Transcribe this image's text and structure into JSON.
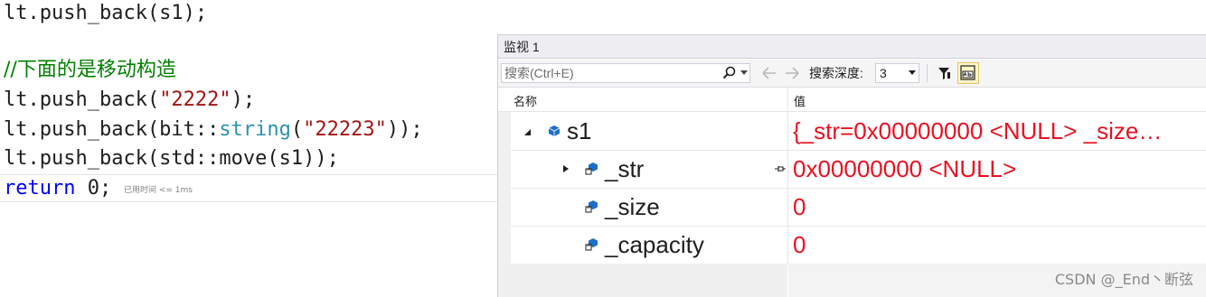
{
  "editor": {
    "line1": {
      "prefix": "lt.push_back(s1);"
    },
    "line3": {
      "comment": "//下面的是移动构造"
    },
    "line4": {
      "a": "lt.push_back(",
      "str": "\"2222\"",
      "b": ");"
    },
    "line5": {
      "a": "lt.push_back(bit::",
      "type": "string",
      "b": "(",
      "str": "\"22223\"",
      "c": "));"
    },
    "line6": {
      "text": "lt.push_back(std::move(s1));"
    },
    "line7": {
      "kw": "return",
      "b": " 0;"
    },
    "elapsed": "已用时间 <= 1ms"
  },
  "watch": {
    "title": "监视 1",
    "search_placeholder": "搜索(Ctrl+E)",
    "depth_label": "搜索深度:",
    "depth_value": "3",
    "col_name": "名称",
    "col_value": "值",
    "rows": [
      {
        "name": "s1",
        "value": "{_str=0x00000000 <NULL> _size…"
      },
      {
        "name": "_str",
        "value": "0x00000000 <NULL>"
      },
      {
        "name": "_size",
        "value": "0"
      },
      {
        "name": "_capacity",
        "value": "0"
      }
    ]
  },
  "colors": {
    "value_text": "#e81123",
    "string_literal": "#a31515",
    "comment": "#008000",
    "keyword": "#0000ff",
    "type": "#2b91af"
  },
  "icons": [
    "search-icon",
    "chevron-down-icon",
    "arrow-left-icon",
    "arrow-right-icon",
    "pin-filter-icon",
    "tab-view-icon",
    "expand-triangle-icon",
    "object-member-icon",
    "pin-icon"
  ],
  "watermark": "CSDN @_End丶断弦"
}
